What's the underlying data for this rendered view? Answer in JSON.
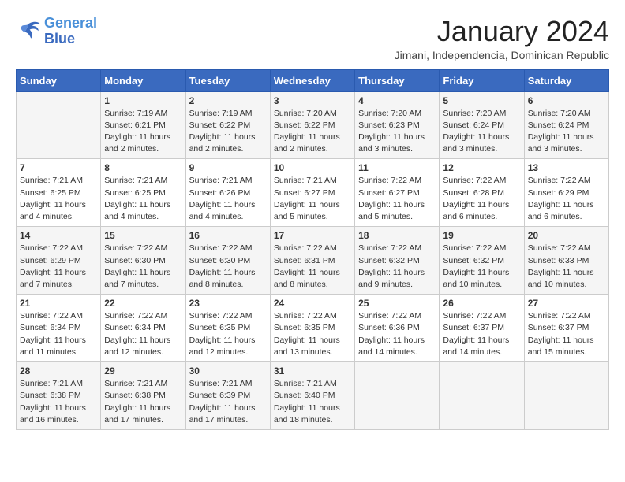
{
  "logo": {
    "line1": "General",
    "line2": "Blue"
  },
  "title": "January 2024",
  "subtitle": "Jimani, Independencia, Dominican Republic",
  "days_header": [
    "Sunday",
    "Monday",
    "Tuesday",
    "Wednesday",
    "Thursday",
    "Friday",
    "Saturday"
  ],
  "weeks": [
    [
      {
        "day": "",
        "info": ""
      },
      {
        "day": "1",
        "info": "Sunrise: 7:19 AM\nSunset: 6:21 PM\nDaylight: 11 hours\nand 2 minutes."
      },
      {
        "day": "2",
        "info": "Sunrise: 7:19 AM\nSunset: 6:22 PM\nDaylight: 11 hours\nand 2 minutes."
      },
      {
        "day": "3",
        "info": "Sunrise: 7:20 AM\nSunset: 6:22 PM\nDaylight: 11 hours\nand 2 minutes."
      },
      {
        "day": "4",
        "info": "Sunrise: 7:20 AM\nSunset: 6:23 PM\nDaylight: 11 hours\nand 3 minutes."
      },
      {
        "day": "5",
        "info": "Sunrise: 7:20 AM\nSunset: 6:24 PM\nDaylight: 11 hours\nand 3 minutes."
      },
      {
        "day": "6",
        "info": "Sunrise: 7:20 AM\nSunset: 6:24 PM\nDaylight: 11 hours\nand 3 minutes."
      }
    ],
    [
      {
        "day": "7",
        "info": "Sunrise: 7:21 AM\nSunset: 6:25 PM\nDaylight: 11 hours\nand 4 minutes."
      },
      {
        "day": "8",
        "info": "Sunrise: 7:21 AM\nSunset: 6:25 PM\nDaylight: 11 hours\nand 4 minutes."
      },
      {
        "day": "9",
        "info": "Sunrise: 7:21 AM\nSunset: 6:26 PM\nDaylight: 11 hours\nand 4 minutes."
      },
      {
        "day": "10",
        "info": "Sunrise: 7:21 AM\nSunset: 6:27 PM\nDaylight: 11 hours\nand 5 minutes."
      },
      {
        "day": "11",
        "info": "Sunrise: 7:22 AM\nSunset: 6:27 PM\nDaylight: 11 hours\nand 5 minutes."
      },
      {
        "day": "12",
        "info": "Sunrise: 7:22 AM\nSunset: 6:28 PM\nDaylight: 11 hours\nand 6 minutes."
      },
      {
        "day": "13",
        "info": "Sunrise: 7:22 AM\nSunset: 6:29 PM\nDaylight: 11 hours\nand 6 minutes."
      }
    ],
    [
      {
        "day": "14",
        "info": "Sunrise: 7:22 AM\nSunset: 6:29 PM\nDaylight: 11 hours\nand 7 minutes."
      },
      {
        "day": "15",
        "info": "Sunrise: 7:22 AM\nSunset: 6:30 PM\nDaylight: 11 hours\nand 7 minutes."
      },
      {
        "day": "16",
        "info": "Sunrise: 7:22 AM\nSunset: 6:30 PM\nDaylight: 11 hours\nand 8 minutes."
      },
      {
        "day": "17",
        "info": "Sunrise: 7:22 AM\nSunset: 6:31 PM\nDaylight: 11 hours\nand 8 minutes."
      },
      {
        "day": "18",
        "info": "Sunrise: 7:22 AM\nSunset: 6:32 PM\nDaylight: 11 hours\nand 9 minutes."
      },
      {
        "day": "19",
        "info": "Sunrise: 7:22 AM\nSunset: 6:32 PM\nDaylight: 11 hours\nand 10 minutes."
      },
      {
        "day": "20",
        "info": "Sunrise: 7:22 AM\nSunset: 6:33 PM\nDaylight: 11 hours\nand 10 minutes."
      }
    ],
    [
      {
        "day": "21",
        "info": "Sunrise: 7:22 AM\nSunset: 6:34 PM\nDaylight: 11 hours\nand 11 minutes."
      },
      {
        "day": "22",
        "info": "Sunrise: 7:22 AM\nSunset: 6:34 PM\nDaylight: 11 hours\nand 12 minutes."
      },
      {
        "day": "23",
        "info": "Sunrise: 7:22 AM\nSunset: 6:35 PM\nDaylight: 11 hours\nand 12 minutes."
      },
      {
        "day": "24",
        "info": "Sunrise: 7:22 AM\nSunset: 6:35 PM\nDaylight: 11 hours\nand 13 minutes."
      },
      {
        "day": "25",
        "info": "Sunrise: 7:22 AM\nSunset: 6:36 PM\nDaylight: 11 hours\nand 14 minutes."
      },
      {
        "day": "26",
        "info": "Sunrise: 7:22 AM\nSunset: 6:37 PM\nDaylight: 11 hours\nand 14 minutes."
      },
      {
        "day": "27",
        "info": "Sunrise: 7:22 AM\nSunset: 6:37 PM\nDaylight: 11 hours\nand 15 minutes."
      }
    ],
    [
      {
        "day": "28",
        "info": "Sunrise: 7:21 AM\nSunset: 6:38 PM\nDaylight: 11 hours\nand 16 minutes."
      },
      {
        "day": "29",
        "info": "Sunrise: 7:21 AM\nSunset: 6:38 PM\nDaylight: 11 hours\nand 17 minutes."
      },
      {
        "day": "30",
        "info": "Sunrise: 7:21 AM\nSunset: 6:39 PM\nDaylight: 11 hours\nand 17 minutes."
      },
      {
        "day": "31",
        "info": "Sunrise: 7:21 AM\nSunset: 6:40 PM\nDaylight: 11 hours\nand 18 minutes."
      },
      {
        "day": "",
        "info": ""
      },
      {
        "day": "",
        "info": ""
      },
      {
        "day": "",
        "info": ""
      }
    ]
  ]
}
